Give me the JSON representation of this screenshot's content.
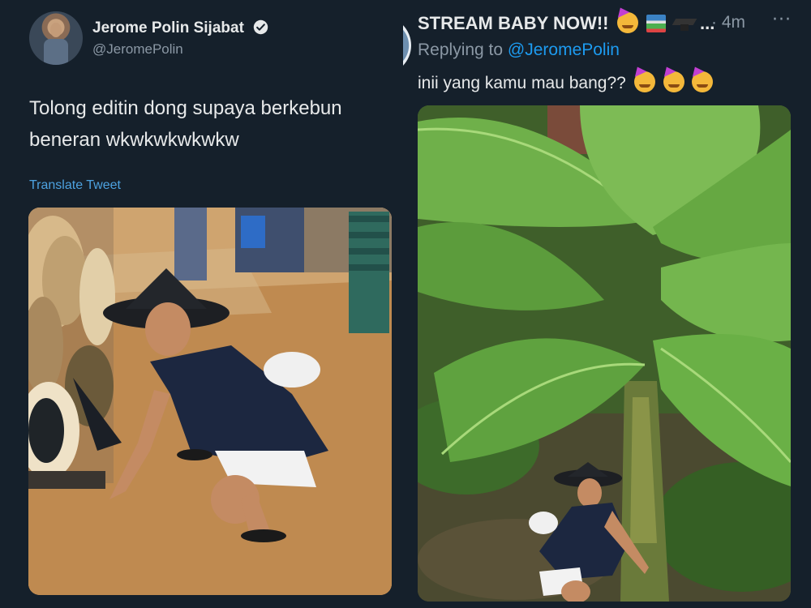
{
  "left_tweet": {
    "display_name": "Jerome Polin Sijabat",
    "handle": "@JeromePolin",
    "text_line1": "Tolong editin dong supaya berkebun",
    "text_line2": "beneran wkwkwkwkwkw",
    "translate_label": "Translate Tweet",
    "verified_icon": "verified-badge-icon"
  },
  "right_tweet": {
    "display_name": "STREAM BABY NOW!!",
    "ellipsis": "...",
    "time": "· 4m",
    "more": "···",
    "replying_prefix": "Replying to",
    "replying_handle": "@JeromePolin",
    "text": "inii yang kamu mau bang??"
  },
  "colors": {
    "background": "#15202b",
    "primary_text": "#e7e9ea",
    "secondary_text": "#8b98a5",
    "link": "#1d9bf0"
  }
}
